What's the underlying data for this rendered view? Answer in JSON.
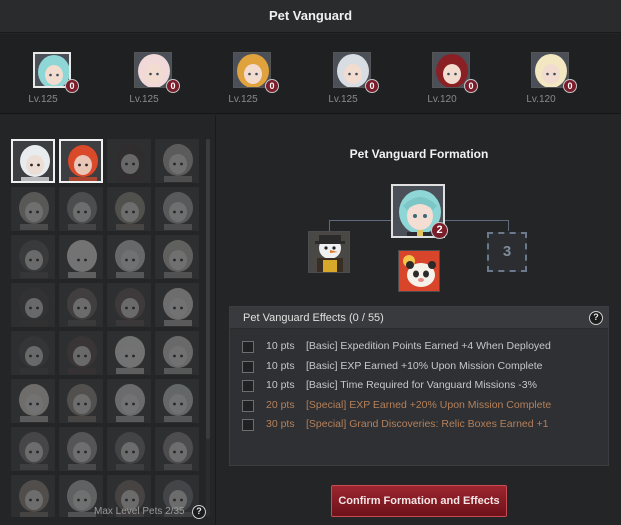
{
  "window": {
    "title": "Pet Vanguard"
  },
  "characters": [
    {
      "level": "Lv.125",
      "badge": "0",
      "hair": "#8fd6d6",
      "selected": true
    },
    {
      "level": "Lv.125",
      "badge": "0",
      "hair": "#f2d9d9",
      "selected": false
    },
    {
      "level": "Lv.125",
      "badge": "0",
      "hair": "#e0a23c",
      "selected": false
    },
    {
      "level": "Lv.125",
      "badge": "0",
      "hair": "#d8dde3",
      "selected": false
    },
    {
      "level": "Lv.120",
      "badge": "0",
      "hair": "#8a1f24",
      "selected": false
    },
    {
      "level": "Lv.120",
      "badge": "0",
      "hair": "#f3e7c2",
      "selected": false
    }
  ],
  "pets": [
    {
      "icon": "snowman-pet-icon",
      "color": "#e9ecef",
      "locked": false,
      "selected": true
    },
    {
      "icon": "panda-pet-icon",
      "color": "#d9492a",
      "locked": false,
      "selected": true
    },
    {
      "icon": "wolf-pet-icon",
      "color": "#7a2a2f",
      "locked": true,
      "selected": false
    },
    {
      "icon": "fox-pet-icon",
      "color": "#c7a37a",
      "locked": true,
      "selected": false
    },
    {
      "icon": "doll-pet-icon",
      "color": "#b89b78",
      "locked": true,
      "selected": false
    },
    {
      "icon": "knight-pet-icon",
      "color": "#7e8794",
      "locked": true,
      "selected": false
    },
    {
      "icon": "gold-knight-pet-icon",
      "color": "#a88a3a",
      "locked": true,
      "selected": false
    },
    {
      "icon": "silver-knight-pet-icon",
      "color": "#9aa3ad",
      "locked": true,
      "selected": false
    },
    {
      "icon": "dark-knight-pet-icon",
      "color": "#5a5560",
      "locked": true,
      "selected": false
    },
    {
      "icon": "white-girl-pet-icon",
      "color": "#e6e0d4",
      "locked": true,
      "selected": false
    },
    {
      "icon": "teal-girl-pet-icon",
      "color": "#9fd0c8",
      "locked": true,
      "selected": false
    },
    {
      "icon": "gold-girl-pet-icon",
      "color": "#c9b07a",
      "locked": true,
      "selected": false
    },
    {
      "icon": "black-hat-pet-icon",
      "color": "#4a4548",
      "locked": true,
      "selected": false
    },
    {
      "icon": "brown-girl-pet-icon",
      "color": "#8a5a4a",
      "locked": true,
      "selected": false
    },
    {
      "icon": "red-hair-pet-icon",
      "color": "#a04a3a",
      "locked": true,
      "selected": false
    },
    {
      "icon": "cat-girl-pet-icon",
      "color": "#e0cfa8",
      "locked": true,
      "selected": false
    },
    {
      "icon": "dark-girl-pet-icon",
      "color": "#4e4a50",
      "locked": true,
      "selected": false
    },
    {
      "icon": "red-hood-pet-icon",
      "color": "#b0303a",
      "locked": true,
      "selected": false
    },
    {
      "icon": "white-cat-pet-icon",
      "color": "#e2ddd2",
      "locked": true,
      "selected": false
    },
    {
      "icon": "owl-pet-icon",
      "color": "#cfc8b8",
      "locked": true,
      "selected": false
    },
    {
      "icon": "blonde-pet-icon",
      "color": "#e8d28a",
      "locked": true,
      "selected": false
    },
    {
      "icon": "gold-armor-pet-icon",
      "color": "#b08a3a",
      "locked": true,
      "selected": false
    },
    {
      "icon": "snowman-dark-pet-icon",
      "color": "#c9ced4",
      "locked": true,
      "selected": false
    },
    {
      "icon": "teal-maid-pet-icon",
      "color": "#8fcfc6",
      "locked": true,
      "selected": false
    },
    {
      "icon": "crown-pet-icon",
      "color": "#8a6a8a",
      "locked": true,
      "selected": false
    },
    {
      "icon": "violet-girl-pet-icon",
      "color": "#a590b8",
      "locked": true,
      "selected": false
    },
    {
      "icon": "armored-pet-icon",
      "color": "#6a7080",
      "locked": true,
      "selected": false
    },
    {
      "icon": "purple-girl-pet-icon",
      "color": "#9a7aa8",
      "locked": true,
      "selected": false
    },
    {
      "icon": "orange-pet-icon",
      "color": "#d8782a",
      "locked": true,
      "selected": false
    },
    {
      "icon": "pale-pet-icon",
      "color": "#a8b8b0",
      "locked": true,
      "selected": false
    },
    {
      "icon": "hat-pet-icon",
      "color": "#b0603a",
      "locked": true,
      "selected": false
    },
    {
      "icon": "blue-pet-icon",
      "color": "#4a7aa0",
      "locked": true,
      "selected": false
    }
  ],
  "left_panel": {
    "max_level_text": "Max Level Pets 2/35"
  },
  "formation": {
    "title": "Pet Vanguard Formation",
    "leader_badge": "2",
    "empty_slot_label": "3"
  },
  "effects": {
    "header": "Pet Vanguard Effects (0 / 55)",
    "items": [
      {
        "pts": "10 pts",
        "text": "[Basic] Expedition Points Earned +4 When Deployed",
        "kind": "basic"
      },
      {
        "pts": "10 pts",
        "text": "[Basic] EXP Earned +10% Upon Mission Complete",
        "kind": "basic"
      },
      {
        "pts": "10 pts",
        "text": "[Basic] Time Required for Vanguard Missions -3%",
        "kind": "basic"
      },
      {
        "pts": "20 pts",
        "text": "[Special] EXP Earned +20% Upon Mission Complete",
        "kind": "special"
      },
      {
        "pts": "30 pts",
        "text": "[Special] Grand Discoveries: Relic Boxes Earned +1",
        "kind": "special"
      }
    ]
  },
  "actions": {
    "confirm_label": "Confirm Formation and Effects"
  },
  "help": {
    "glyph": "?"
  }
}
